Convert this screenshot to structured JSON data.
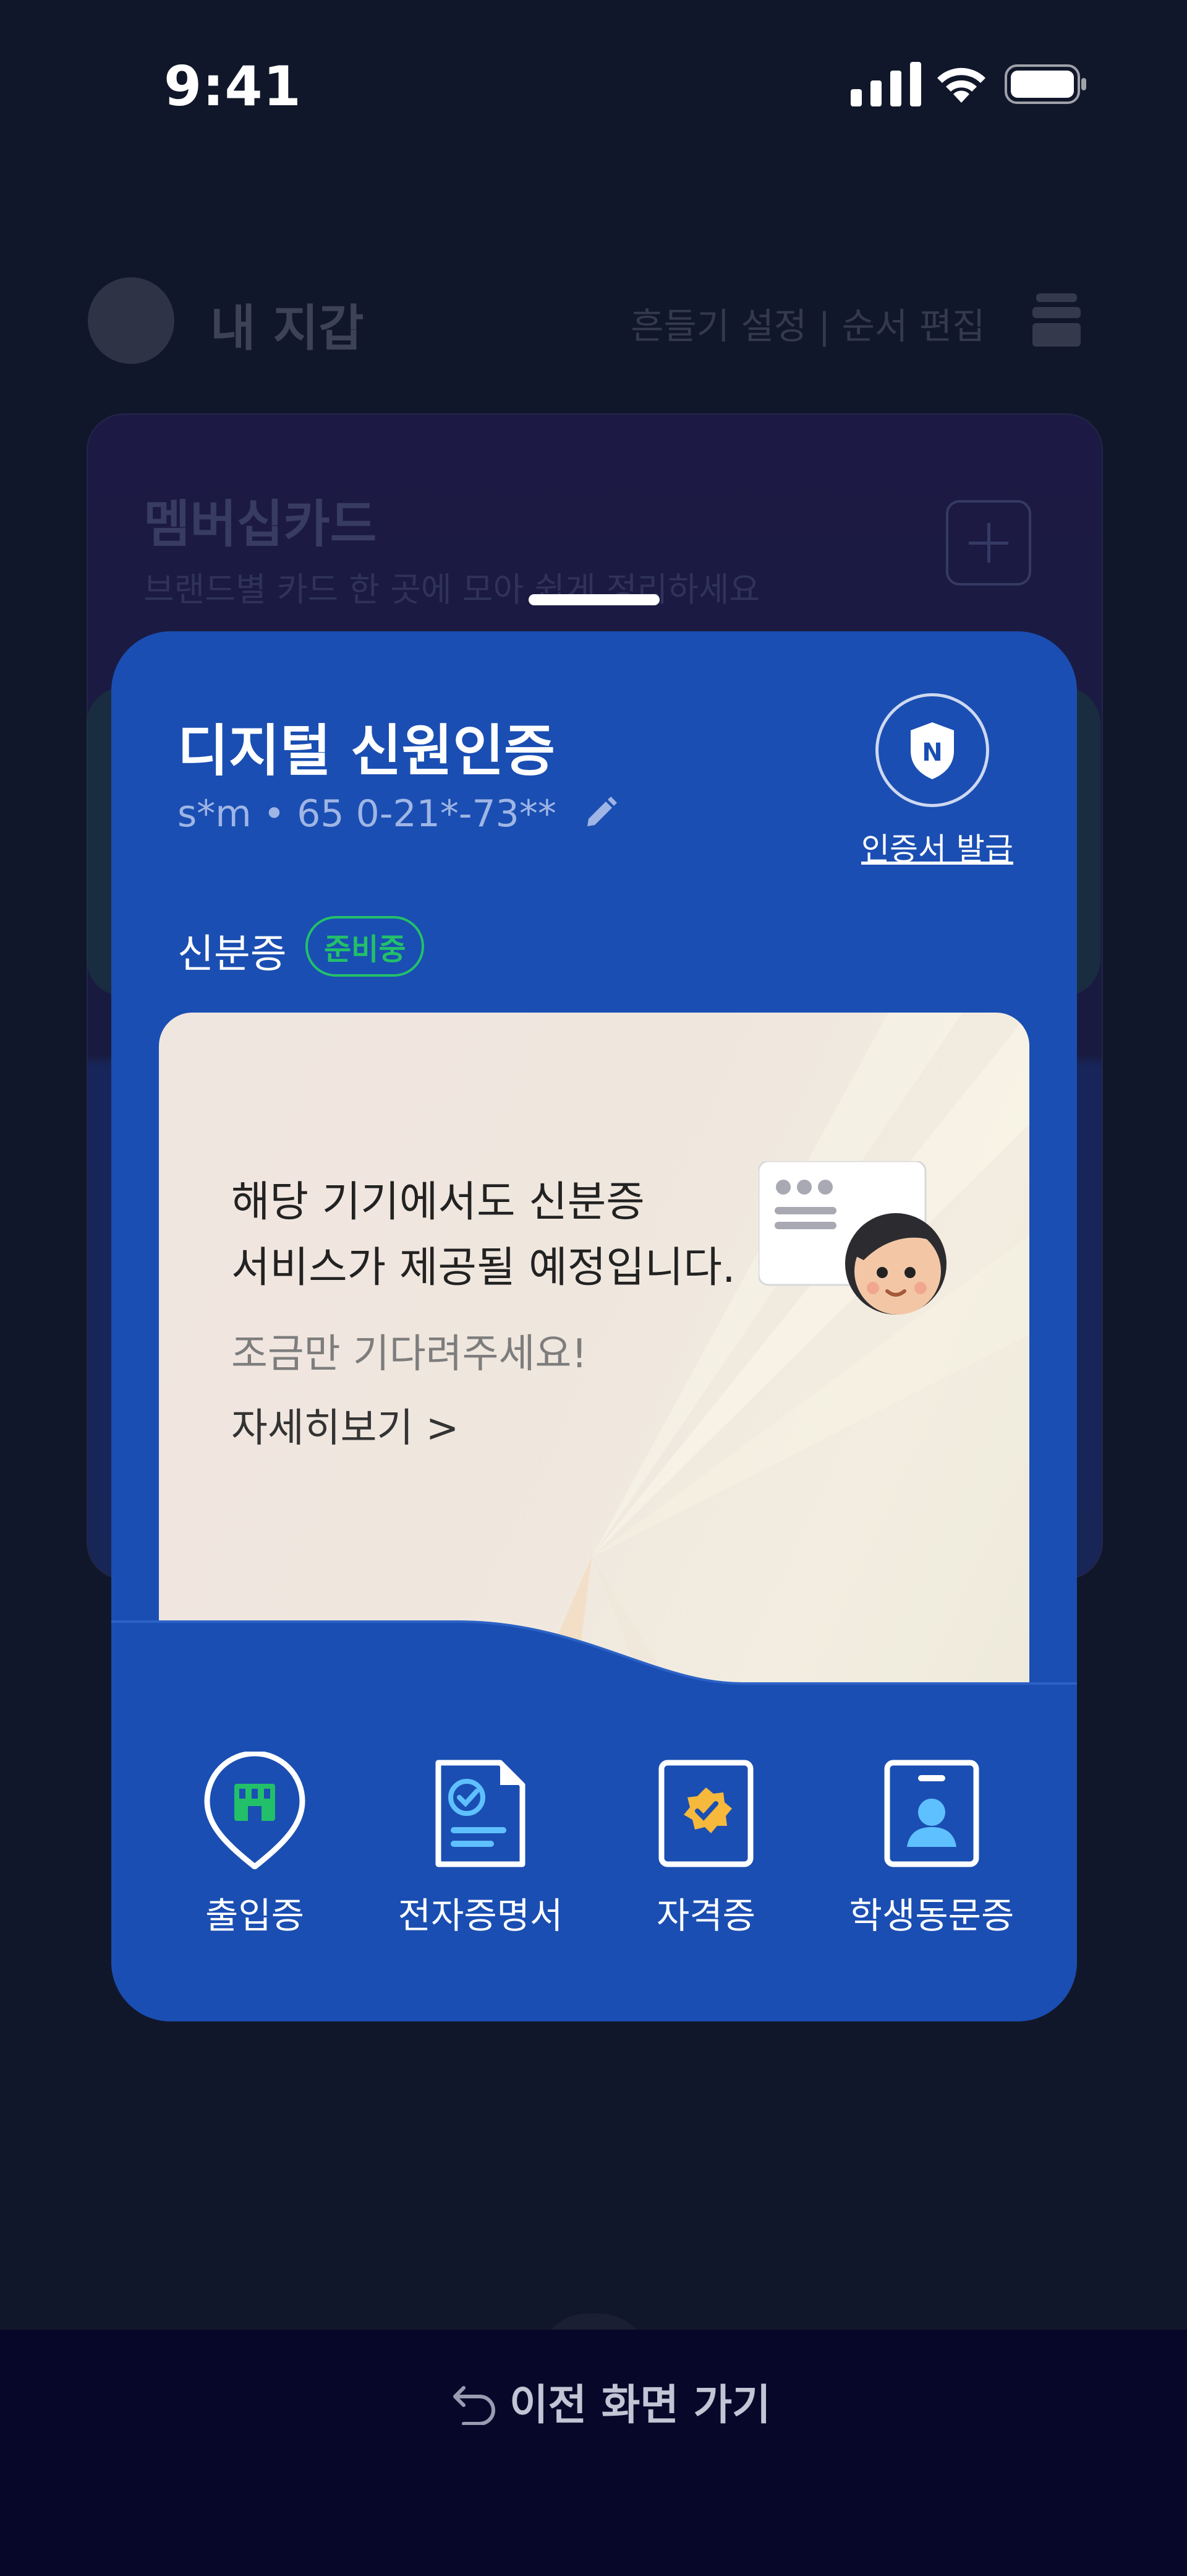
{
  "status_bar": {
    "time": "9:41"
  },
  "background": {
    "title": "내 지갑",
    "links": "흔들기 설정 | 순서 편집",
    "membership_title": "멤버십카드",
    "membership_sub": "브랜드별 카드 한 곳에 모아 쉽게 정리하세요"
  },
  "card": {
    "title": "디지털 신원인증",
    "subtitle": "s*m  •  65 0-21*-73**",
    "cert_button": "인증서 발급",
    "id_label": "신분증",
    "badge": "준비중",
    "info": {
      "line1": "해당 기기에서도 신분증",
      "line2": "서비스가 제공될 예정입니다.",
      "sub": "조금만 기다려주세요!",
      "more": "자세히보기 >"
    },
    "shortcuts": [
      {
        "label": "출입증",
        "icon": "entry-pass-icon"
      },
      {
        "label": "전자증명서",
        "icon": "e-certificate-icon"
      },
      {
        "label": "자격증",
        "icon": "license-icon"
      },
      {
        "label": "학생동문증",
        "icon": "student-id-icon"
      }
    ]
  },
  "bottom": {
    "back_label": "이전 화면 가기"
  }
}
